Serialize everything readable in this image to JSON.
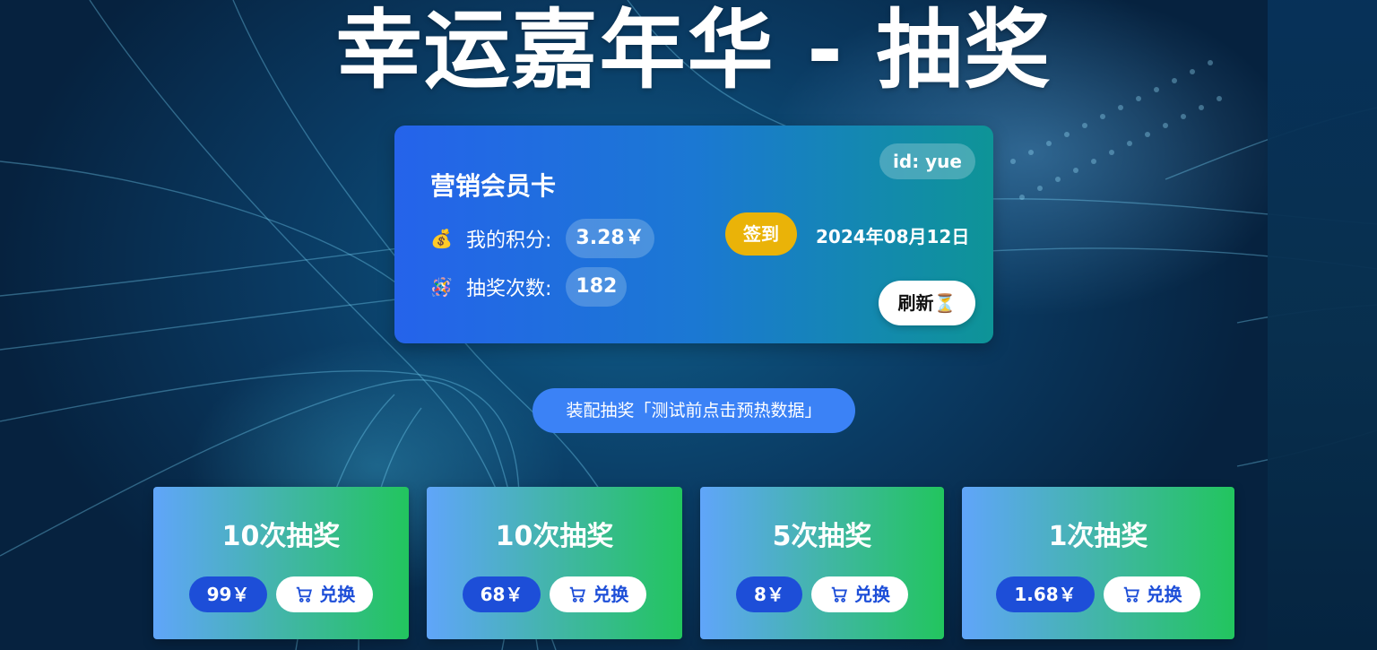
{
  "page": {
    "title": "幸运嘉年华 - 抽奖"
  },
  "member_card": {
    "title": "营销会员卡",
    "id_badge": "id: yue",
    "points_icon": "money-bag",
    "points_label": "我的积分:",
    "points_value": "3.28￥",
    "draws_icon": "pinata",
    "draws_label": "抽奖次数:",
    "draws_value": "182",
    "checkin_label": "签到",
    "date": "2024年08月12日",
    "refresh_label": "刷新⏳"
  },
  "assemble_button": {
    "label": "装配抽奖「测试前点击预热数据」"
  },
  "lottery_options": [
    {
      "title": "10次抽奖",
      "price": "99￥",
      "exchange_label": "兑换"
    },
    {
      "title": "10次抽奖",
      "price": "68￥",
      "exchange_label": "兑换"
    },
    {
      "title": "5次抽奖",
      "price": "8￥",
      "exchange_label": "兑换"
    },
    {
      "title": "1次抽奖",
      "price": "1.68￥",
      "exchange_label": "兑换"
    }
  ],
  "colors": {
    "card_gradient_start": "#2563eb",
    "card_gradient_end": "#0e9497",
    "checkin": "#eab308",
    "assemble": "#3b82f6",
    "price_pill": "#1d4ed8",
    "option_gradient_start": "#60a5fa",
    "option_gradient_end": "#22c55e"
  }
}
